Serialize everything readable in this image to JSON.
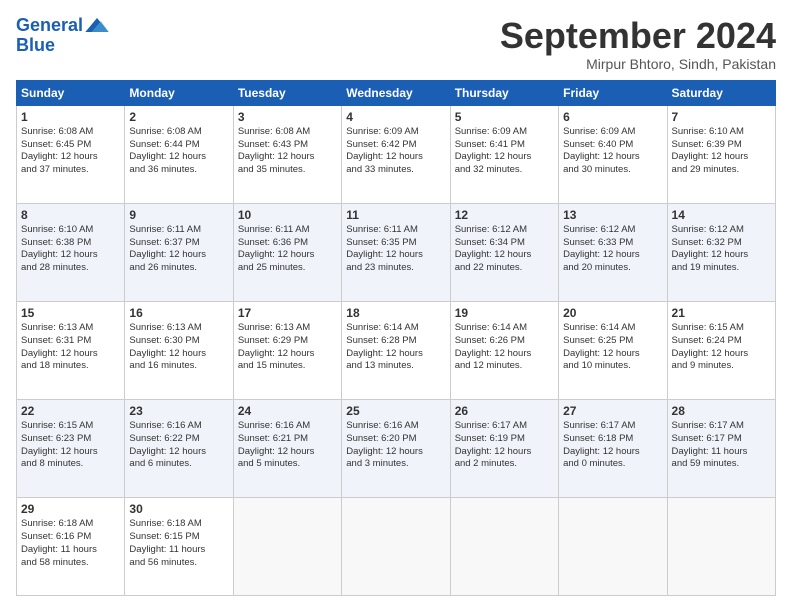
{
  "header": {
    "logo_line1": "General",
    "logo_line2": "Blue",
    "month_title": "September 2024",
    "location": "Mirpur Bhtoro, Sindh, Pakistan"
  },
  "columns": [
    "Sunday",
    "Monday",
    "Tuesday",
    "Wednesday",
    "Thursday",
    "Friday",
    "Saturday"
  ],
  "weeks": [
    [
      {
        "day": "1",
        "lines": [
          "Sunrise: 6:08 AM",
          "Sunset: 6:45 PM",
          "Daylight: 12 hours",
          "and 37 minutes."
        ]
      },
      {
        "day": "2",
        "lines": [
          "Sunrise: 6:08 AM",
          "Sunset: 6:44 PM",
          "Daylight: 12 hours",
          "and 36 minutes."
        ]
      },
      {
        "day": "3",
        "lines": [
          "Sunrise: 6:08 AM",
          "Sunset: 6:43 PM",
          "Daylight: 12 hours",
          "and 35 minutes."
        ]
      },
      {
        "day": "4",
        "lines": [
          "Sunrise: 6:09 AM",
          "Sunset: 6:42 PM",
          "Daylight: 12 hours",
          "and 33 minutes."
        ]
      },
      {
        "day": "5",
        "lines": [
          "Sunrise: 6:09 AM",
          "Sunset: 6:41 PM",
          "Daylight: 12 hours",
          "and 32 minutes."
        ]
      },
      {
        "day": "6",
        "lines": [
          "Sunrise: 6:09 AM",
          "Sunset: 6:40 PM",
          "Daylight: 12 hours",
          "and 30 minutes."
        ]
      },
      {
        "day": "7",
        "lines": [
          "Sunrise: 6:10 AM",
          "Sunset: 6:39 PM",
          "Daylight: 12 hours",
          "and 29 minutes."
        ]
      }
    ],
    [
      {
        "day": "8",
        "lines": [
          "Sunrise: 6:10 AM",
          "Sunset: 6:38 PM",
          "Daylight: 12 hours",
          "and 28 minutes."
        ]
      },
      {
        "day": "9",
        "lines": [
          "Sunrise: 6:11 AM",
          "Sunset: 6:37 PM",
          "Daylight: 12 hours",
          "and 26 minutes."
        ]
      },
      {
        "day": "10",
        "lines": [
          "Sunrise: 6:11 AM",
          "Sunset: 6:36 PM",
          "Daylight: 12 hours",
          "and 25 minutes."
        ]
      },
      {
        "day": "11",
        "lines": [
          "Sunrise: 6:11 AM",
          "Sunset: 6:35 PM",
          "Daylight: 12 hours",
          "and 23 minutes."
        ]
      },
      {
        "day": "12",
        "lines": [
          "Sunrise: 6:12 AM",
          "Sunset: 6:34 PM",
          "Daylight: 12 hours",
          "and 22 minutes."
        ]
      },
      {
        "day": "13",
        "lines": [
          "Sunrise: 6:12 AM",
          "Sunset: 6:33 PM",
          "Daylight: 12 hours",
          "and 20 minutes."
        ]
      },
      {
        "day": "14",
        "lines": [
          "Sunrise: 6:12 AM",
          "Sunset: 6:32 PM",
          "Daylight: 12 hours",
          "and 19 minutes."
        ]
      }
    ],
    [
      {
        "day": "15",
        "lines": [
          "Sunrise: 6:13 AM",
          "Sunset: 6:31 PM",
          "Daylight: 12 hours",
          "and 18 minutes."
        ]
      },
      {
        "day": "16",
        "lines": [
          "Sunrise: 6:13 AM",
          "Sunset: 6:30 PM",
          "Daylight: 12 hours",
          "and 16 minutes."
        ]
      },
      {
        "day": "17",
        "lines": [
          "Sunrise: 6:13 AM",
          "Sunset: 6:29 PM",
          "Daylight: 12 hours",
          "and 15 minutes."
        ]
      },
      {
        "day": "18",
        "lines": [
          "Sunrise: 6:14 AM",
          "Sunset: 6:28 PM",
          "Daylight: 12 hours",
          "and 13 minutes."
        ]
      },
      {
        "day": "19",
        "lines": [
          "Sunrise: 6:14 AM",
          "Sunset: 6:26 PM",
          "Daylight: 12 hours",
          "and 12 minutes."
        ]
      },
      {
        "day": "20",
        "lines": [
          "Sunrise: 6:14 AM",
          "Sunset: 6:25 PM",
          "Daylight: 12 hours",
          "and 10 minutes."
        ]
      },
      {
        "day": "21",
        "lines": [
          "Sunrise: 6:15 AM",
          "Sunset: 6:24 PM",
          "Daylight: 12 hours",
          "and 9 minutes."
        ]
      }
    ],
    [
      {
        "day": "22",
        "lines": [
          "Sunrise: 6:15 AM",
          "Sunset: 6:23 PM",
          "Daylight: 12 hours",
          "and 8 minutes."
        ]
      },
      {
        "day": "23",
        "lines": [
          "Sunrise: 6:16 AM",
          "Sunset: 6:22 PM",
          "Daylight: 12 hours",
          "and 6 minutes."
        ]
      },
      {
        "day": "24",
        "lines": [
          "Sunrise: 6:16 AM",
          "Sunset: 6:21 PM",
          "Daylight: 12 hours",
          "and 5 minutes."
        ]
      },
      {
        "day": "25",
        "lines": [
          "Sunrise: 6:16 AM",
          "Sunset: 6:20 PM",
          "Daylight: 12 hours",
          "and 3 minutes."
        ]
      },
      {
        "day": "26",
        "lines": [
          "Sunrise: 6:17 AM",
          "Sunset: 6:19 PM",
          "Daylight: 12 hours",
          "and 2 minutes."
        ]
      },
      {
        "day": "27",
        "lines": [
          "Sunrise: 6:17 AM",
          "Sunset: 6:18 PM",
          "Daylight: 12 hours",
          "and 0 minutes."
        ]
      },
      {
        "day": "28",
        "lines": [
          "Sunrise: 6:17 AM",
          "Sunset: 6:17 PM",
          "Daylight: 11 hours",
          "and 59 minutes."
        ]
      }
    ],
    [
      {
        "day": "29",
        "lines": [
          "Sunrise: 6:18 AM",
          "Sunset: 6:16 PM",
          "Daylight: 11 hours",
          "and 58 minutes."
        ]
      },
      {
        "day": "30",
        "lines": [
          "Sunrise: 6:18 AM",
          "Sunset: 6:15 PM",
          "Daylight: 11 hours",
          "and 56 minutes."
        ]
      },
      {
        "day": "",
        "lines": []
      },
      {
        "day": "",
        "lines": []
      },
      {
        "day": "",
        "lines": []
      },
      {
        "day": "",
        "lines": []
      },
      {
        "day": "",
        "lines": []
      }
    ]
  ]
}
